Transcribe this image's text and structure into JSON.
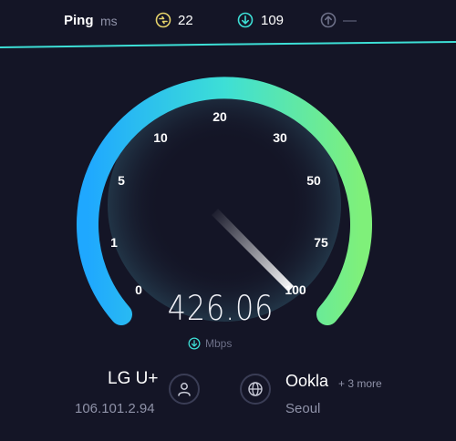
{
  "ping": {
    "label": "Ping",
    "unit": "ms",
    "jitter_icon": "jitter-icon",
    "jitter_value": "22",
    "download_icon": "download-arrow-icon",
    "download_value": "109",
    "upload_icon": "upload-arrow-icon",
    "upload_value": "—"
  },
  "gauge": {
    "ticks": [
      "0",
      "1",
      "5",
      "10",
      "20",
      "30",
      "50",
      "75",
      "100"
    ],
    "speed": "426.06",
    "unit": "Mbps",
    "unit_icon": "download-arrow-icon",
    "colors": {
      "start": "#1fa8ff",
      "middle": "#3ddfd6",
      "end": "#7ff07a",
      "needle": "#ffffff"
    }
  },
  "provider": {
    "name": "LG U+",
    "ip": "106.101.2.94",
    "icon": "user-icon"
  },
  "server": {
    "name": "Ookla",
    "more": "+ 3 more",
    "city": "Seoul",
    "icon": "globe-icon"
  },
  "colors": {
    "background": "#141526",
    "accent": "#3ddfd6",
    "jitter": "#e6d36b",
    "muted": "#8f92a8"
  }
}
